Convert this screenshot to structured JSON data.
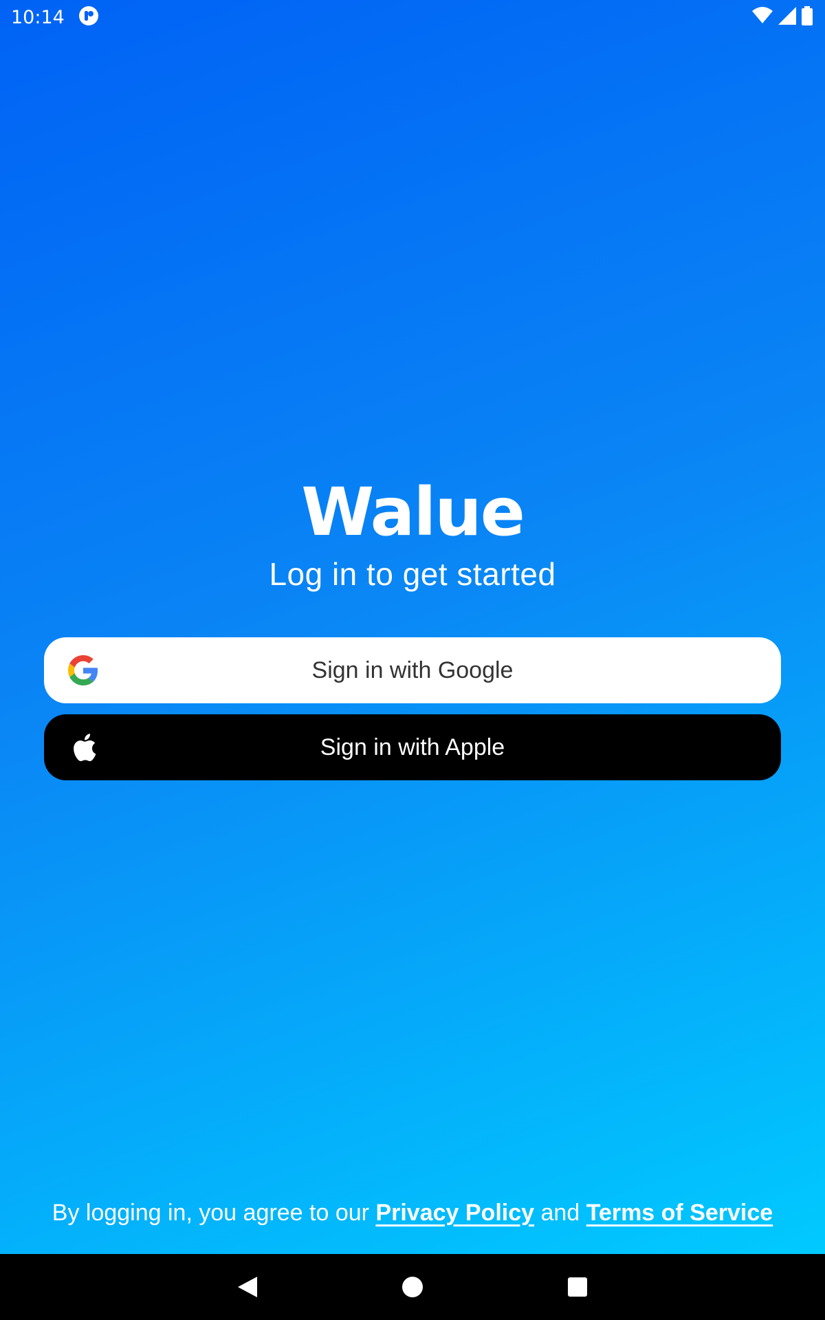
{
  "status_bar": {
    "time": "10:14",
    "icons": [
      "notification-app-icon",
      "wifi-icon",
      "cell-signal-icon",
      "battery-icon"
    ]
  },
  "app": {
    "brand": "Walue",
    "subtitle": "Log in to get started"
  },
  "buttons": {
    "google": {
      "label": "Sign in with Google",
      "icon": "google-icon",
      "bg": "#ffffff"
    },
    "apple": {
      "label": "Sign in with Apple",
      "icon": "apple-icon",
      "bg": "#000000"
    }
  },
  "footer": {
    "prefix": "By logging in, you agree to our",
    "privacy_link": "Privacy Policy",
    "and": "and",
    "terms_link": "Terms of Service"
  },
  "nav": {
    "icons": [
      "back-icon",
      "home-icon",
      "recents-icon"
    ]
  },
  "colors": {
    "gradient_top": "#0062f5",
    "gradient_bottom": "#00cfff"
  }
}
